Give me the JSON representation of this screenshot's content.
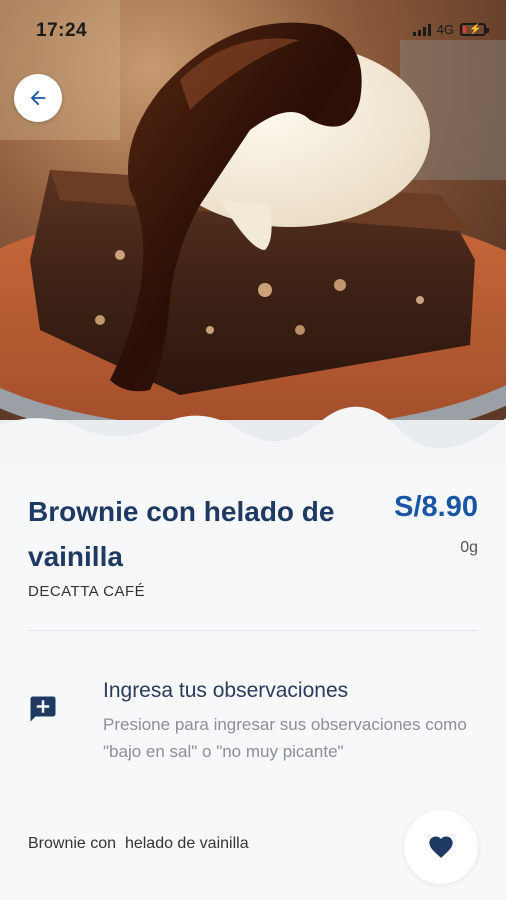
{
  "status_bar": {
    "time": "17:24",
    "network": "4G",
    "battery_level": 0.15
  },
  "header": {
    "back_icon": "arrow-left-icon"
  },
  "product": {
    "name": "Brownie con helado de vainilla",
    "price": "S/8.90",
    "weight": "0g",
    "vendor": "DECATTA CAFÉ",
    "image_icon": "brownie-photo"
  },
  "observations": {
    "icon": "comment-add-icon",
    "title": "Ingresa tus observaciones",
    "description": "Presione para ingresar sus observaciones como \"bajo en sal\" o \"no muy picante\""
  },
  "footer": {
    "item_name": "Brownie con  helado de vainilla",
    "favorite_icon": "heart-icon"
  },
  "colors": {
    "title": "#1f3a62",
    "price": "#1a56a8",
    "accent": "#1a4d8f",
    "background": "#f7f8fa"
  }
}
